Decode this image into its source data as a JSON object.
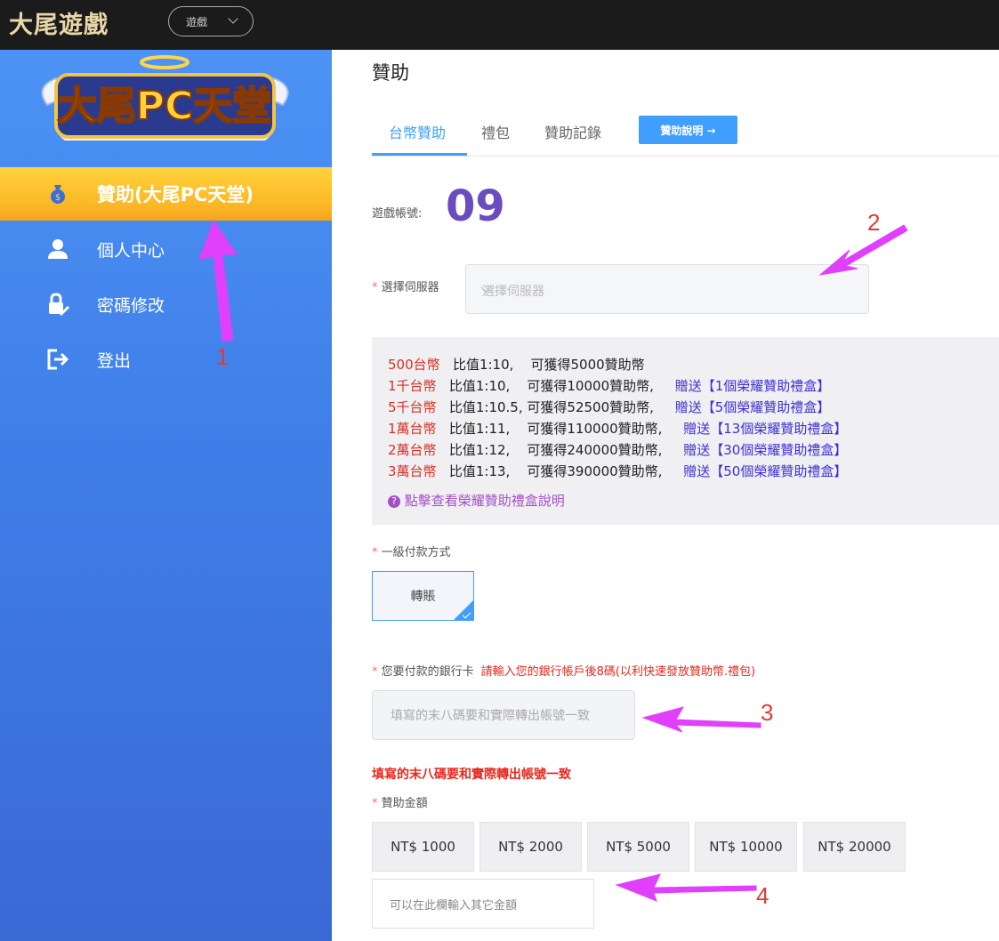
{
  "topbar": {
    "brand": "大尾遊戲",
    "game_select": "遊戲"
  },
  "sidebar": {
    "items": [
      {
        "label": "贊助(大尾PC天堂)",
        "icon": "money-bag-icon",
        "active": true
      },
      {
        "label": "個人中心",
        "icon": "user-icon",
        "active": false
      },
      {
        "label": "密碼修改",
        "icon": "lock-edit-icon",
        "active": false
      },
      {
        "label": "登出",
        "icon": "logout-icon",
        "active": false
      }
    ]
  },
  "main": {
    "title": "贊助",
    "tabs": [
      {
        "label": "台幣贊助",
        "active": true
      },
      {
        "label": "禮包",
        "active": false
      },
      {
        "label": "贊助記錄",
        "active": false
      }
    ],
    "help_button": "贊助說明 →",
    "account": {
      "label": "遊戲帳號:",
      "value": "09"
    },
    "server": {
      "label": "選擇伺服器",
      "placeholder": "選擇伺服器"
    },
    "rates": [
      {
        "amount": "500台幣",
        "ratio": "比值1:10,",
        "gain": "可獲得5000贊助幣",
        "bonus": ""
      },
      {
        "amount": "1千台幣",
        "ratio": "比值1:10,",
        "gain": "可獲得10000贊助幣,",
        "bonus": "贈送【1個榮耀贊助禮盒】"
      },
      {
        "amount": "5千台幣",
        "ratio": "比值1:10.5,",
        "gain": "可獲得52500贊助幣,",
        "bonus": "贈送【5個榮耀贊助禮盒】"
      },
      {
        "amount": "1萬台幣",
        "ratio": "比值1:11,",
        "gain": "可獲得110000贊助幣,",
        "bonus": "贈送【13個榮耀贊助禮盒】"
      },
      {
        "amount": "2萬台幣",
        "ratio": "比值1:12,",
        "gain": "可獲得240000贊助幣,",
        "bonus": "贈送【30個榮耀贊助禮盒】"
      },
      {
        "amount": "3萬台幣",
        "ratio": "比值1:13,",
        "gain": "可獲得390000贊助幣,",
        "bonus": "贈送【50個榮耀贊助禮盒】"
      }
    ],
    "rate_help": "點擊查看榮耀贊助禮盒說明",
    "payment": {
      "label": "一級付款方式",
      "option": "轉賬"
    },
    "bank": {
      "label": "您要付款的銀行卡",
      "hint": "請輸入您的銀行帳戶後8碼(以利快速發放贊助幣.禮包)",
      "placeholder": "填寫的末八碼要和實際轉出帳號一致",
      "warning": "填寫的末八碼要和實際轉出帳號一致"
    },
    "amount": {
      "label": "贊助金額",
      "options": [
        "NT$ 1000",
        "NT$ 2000",
        "NT$ 5000",
        "NT$ 10000",
        "NT$ 20000"
      ],
      "other_placeholder": "可以在此欄輸入其它金額"
    }
  },
  "annotations": [
    "1",
    "2",
    "3",
    "4"
  ],
  "colors": {
    "accent": "#409eff",
    "sidebar": "#3f7ee8",
    "active_item": "#fbb826",
    "annotation_arrow": "#e040fb"
  }
}
